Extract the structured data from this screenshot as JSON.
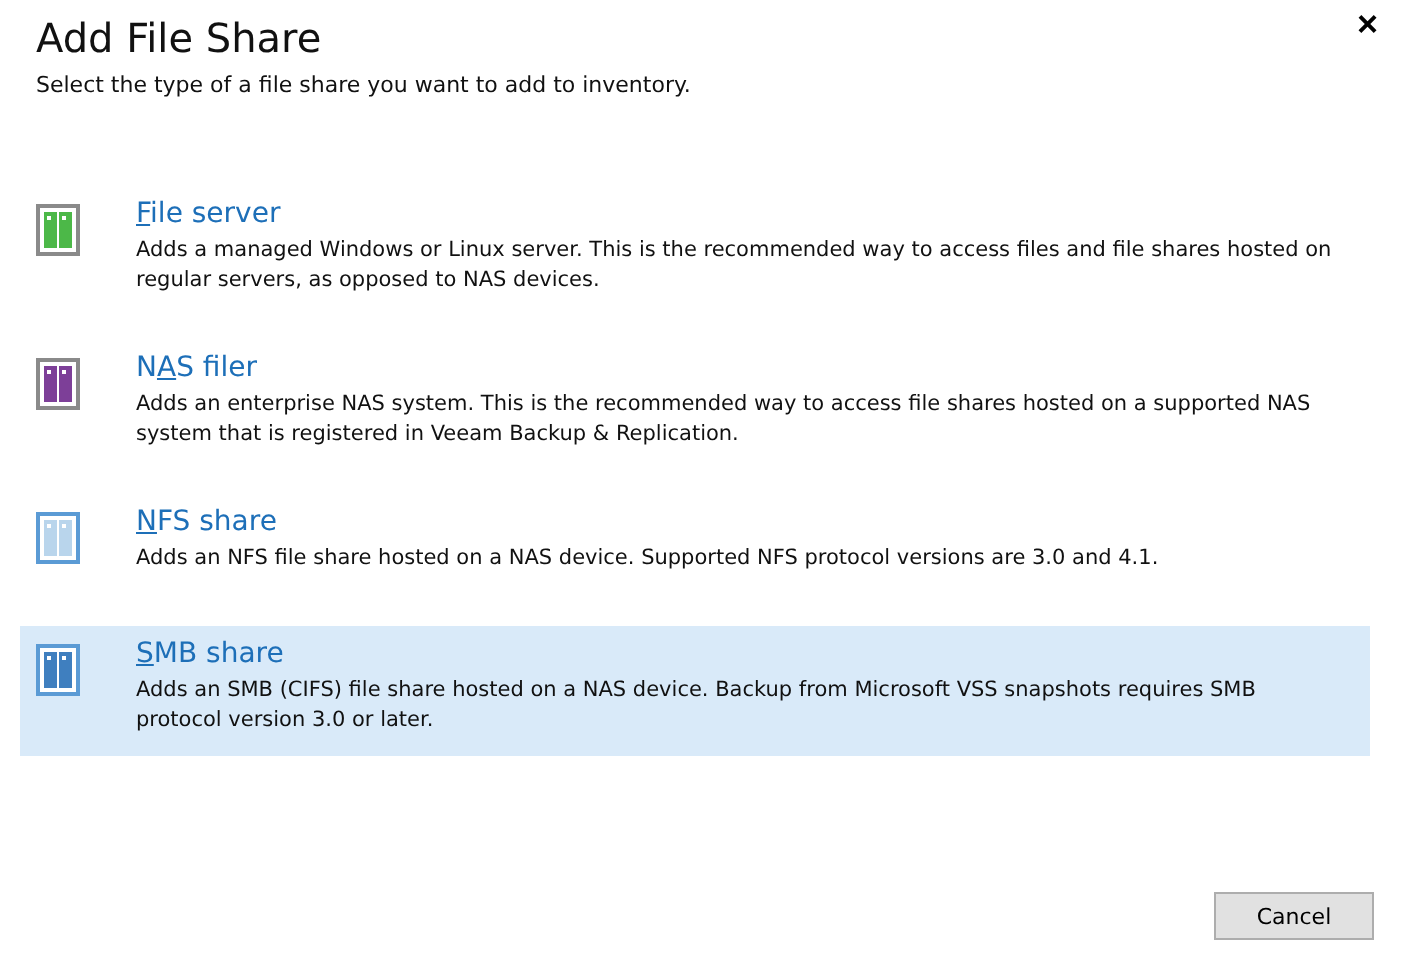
{
  "window": {
    "title": "Add File Share",
    "subtitle": "Select the type of a file share you want to add to inventory.",
    "close": "×"
  },
  "options": [
    {
      "access_key": "F",
      "title_rest": "ile server",
      "kind": "server",
      "color": "#4cb848",
      "description": "Adds a managed Windows or Linux server. This is the recommended way to access files and file shares hosted on regular servers, as opposed to NAS devices.",
      "selected": false
    },
    {
      "title_start": "N",
      "access_key": "A",
      "title_rest": "S filer",
      "kind": "server",
      "color": "#7d3f98",
      "description": "Adds an enterprise NAS system. This is the recommended way to access file shares hosted on a supported NAS system that is registered in Veeam Backup & Replication.",
      "selected": false
    },
    {
      "access_key": "N",
      "title_rest": "FS share",
      "kind": "share",
      "color": "#b9d5ec",
      "description": "Adds an NFS file share hosted on a NAS device. Supported NFS protocol versions are 3.0 and 4.1.",
      "selected": false
    },
    {
      "access_key": "S",
      "title_rest": "MB share",
      "kind": "share",
      "color": "#3f7fbf",
      "description": "Adds an SMB (CIFS) file share hosted on a NAS device. Backup from Microsoft VSS snapshots requires SMB protocol version 3.0 or later.",
      "selected": true
    }
  ],
  "buttons": [
    "Cancel"
  ]
}
